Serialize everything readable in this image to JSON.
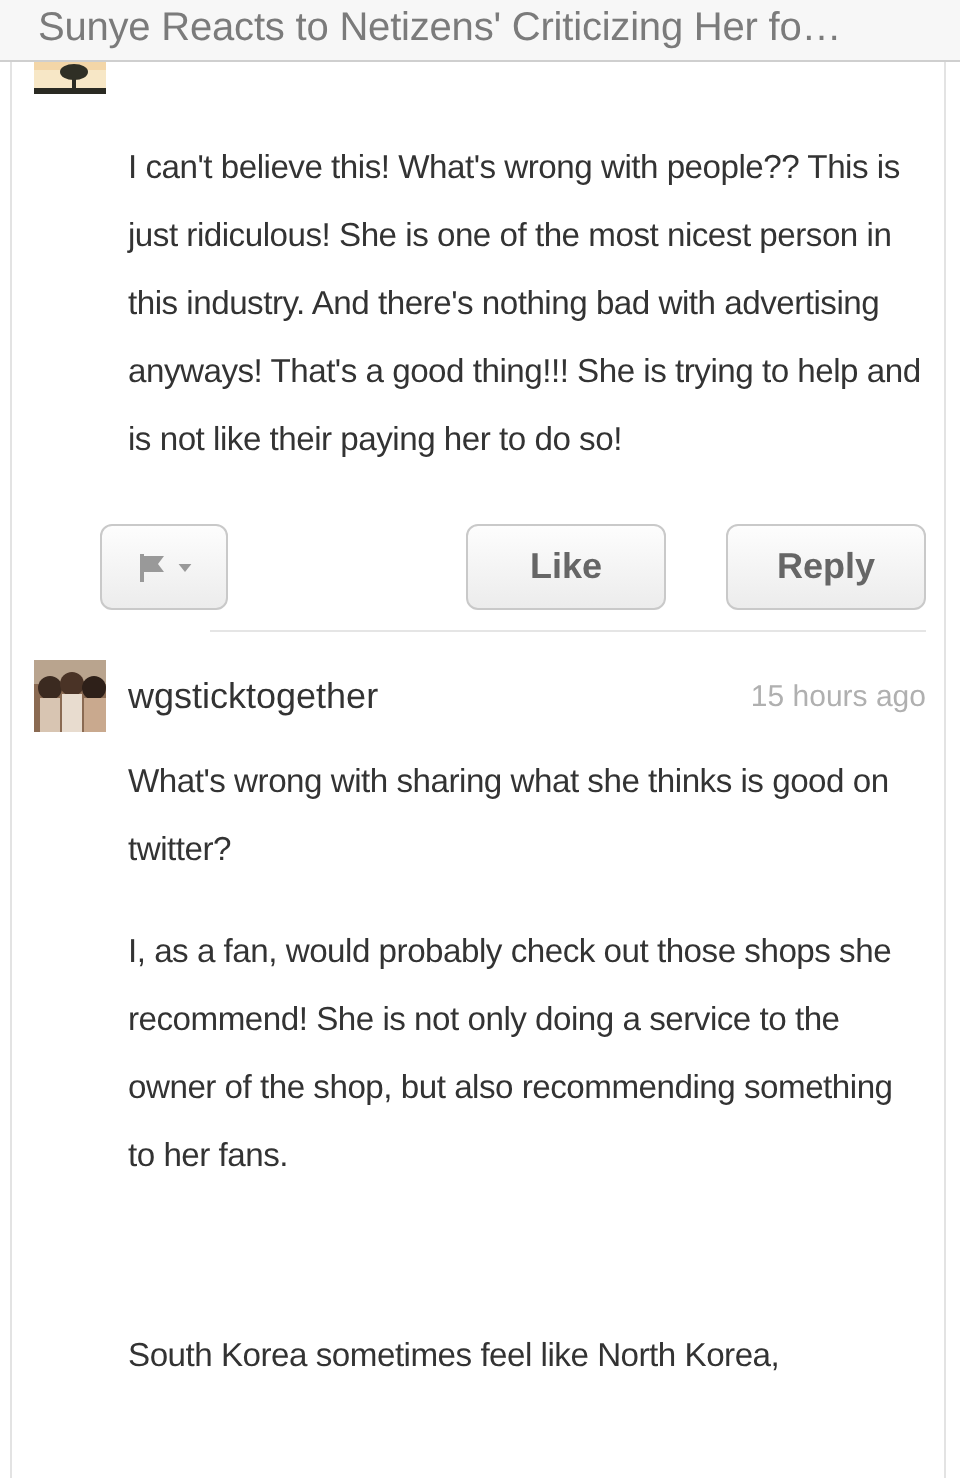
{
  "header": {
    "title": "Sunye Reacts to Netizens' Criticizing Her fo…"
  },
  "comments": [
    {
      "paragraphs": [
        "I can't believe this! What's wrong with people?? This is just ridiculous! She is one of the most nicest person in this industry. And there's nothing bad with advertising anyways! That's a good thing!!! She is trying to help and is not like their paying her to do so!"
      ],
      "actions": [
        "Like",
        "Reply"
      ]
    },
    {
      "author": "wgsticktogether",
      "time": "15 hours ago",
      "paragraphs": [
        "What's wrong with sharing what she thinks is good on twitter?",
        "I, as a fan, would probably check out those shops she recommend! She is not only doing a service to the owner of the shop, but also recommending something to her fans.",
        "South Korea sometimes feel like North Korea,"
      ]
    }
  ]
}
